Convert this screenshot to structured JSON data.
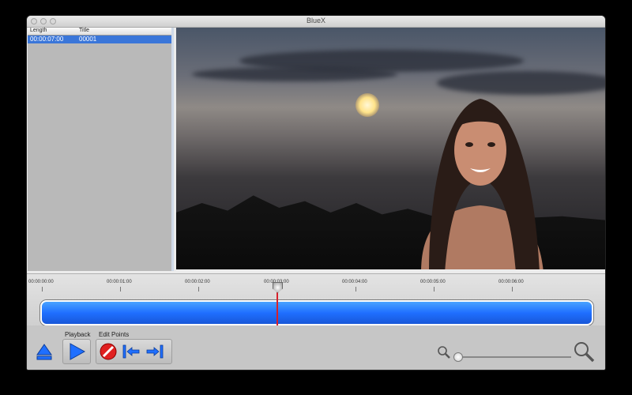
{
  "window": {
    "title": "BlueX"
  },
  "clip_list": {
    "columns": [
      "Length",
      "Title"
    ],
    "rows": [
      {
        "length": "00:00:07:00",
        "title": "00001",
        "selected": true
      }
    ]
  },
  "timeline": {
    "ticks": [
      "00:00:00:00",
      "00:00:01:00",
      "00:00:02:00",
      "00:00:03:00",
      "00:00:04:00",
      "00:00:05:00",
      "00:00:06:00"
    ],
    "playhead_label": "00:00:03:00"
  },
  "controls": {
    "playback_label": "Playback",
    "edit_points_label": "Edit Points",
    "icons": {
      "eject": "eject-icon",
      "play": "play-icon",
      "clear": "no-entry-icon",
      "mark_in": "mark-in-icon",
      "mark_out": "mark-out-icon",
      "zoom_out": "zoom-out-icon",
      "zoom_in": "zoom-in-icon"
    }
  },
  "colors": {
    "accent": "#1f6fff",
    "selection": "#3a76d9",
    "playhead": "#d8202a"
  }
}
